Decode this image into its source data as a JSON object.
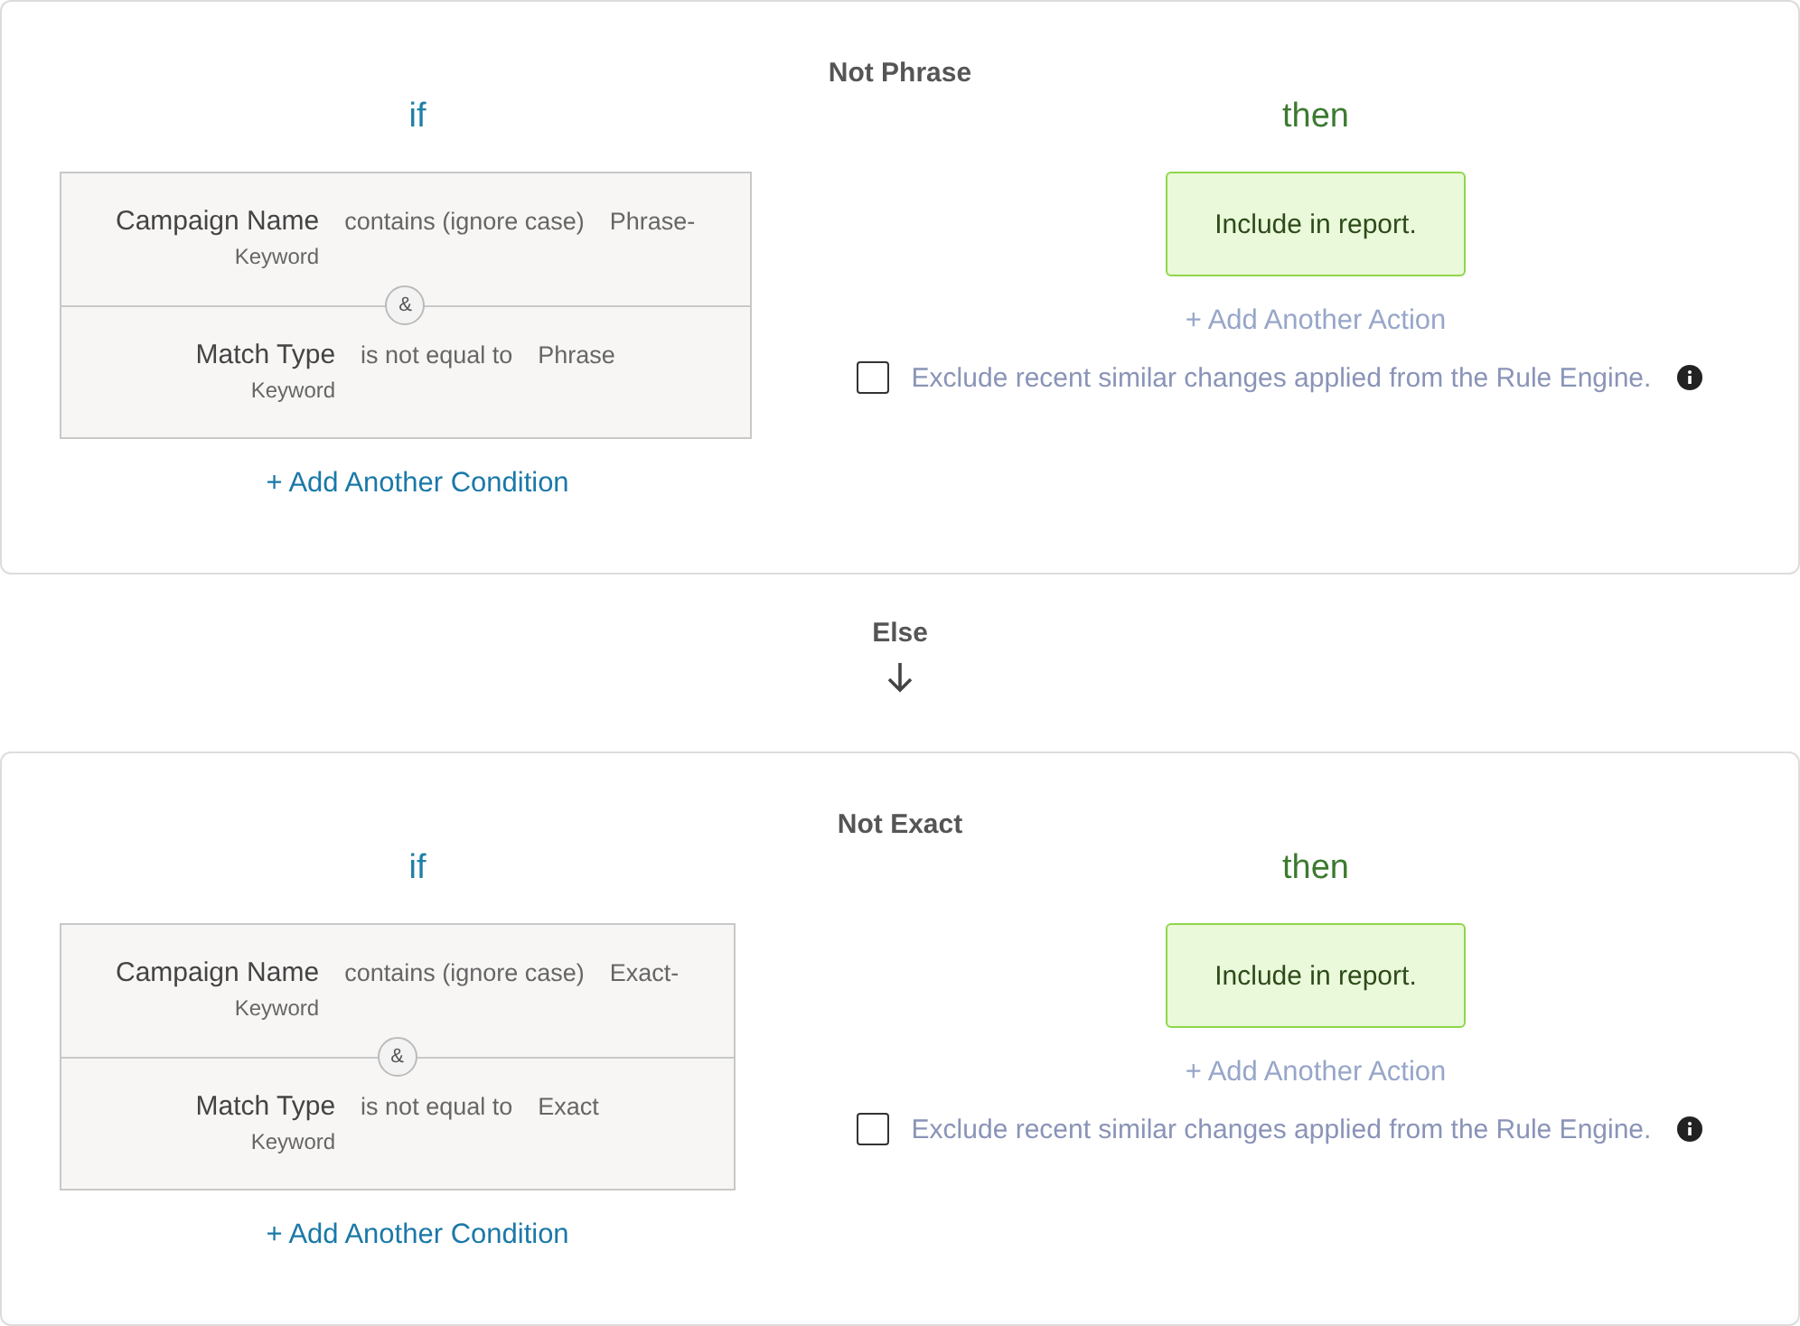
{
  "rules": [
    {
      "title": "Not Phrase",
      "if_label": "if",
      "then_label": "then",
      "conditions": [
        {
          "field": "Campaign Name",
          "entity": "Keyword",
          "operator": "contains (ignore case)",
          "value": "Phrase-"
        },
        {
          "field": "Match Type",
          "entity": "Keyword",
          "operator": "is not equal to",
          "value": "Phrase"
        }
      ],
      "joiner": "&",
      "add_condition": "+ Add Another Condition",
      "action": "Include in report.",
      "add_action": "+ Add Another Action",
      "exclude": {
        "label": "Exclude recent similar changes applied from the Rule Engine.",
        "checked": false
      }
    },
    {
      "title": "Not Exact",
      "if_label": "if",
      "then_label": "then",
      "conditions": [
        {
          "field": "Campaign Name",
          "entity": "Keyword",
          "operator": "contains (ignore case)",
          "value": "Exact-"
        },
        {
          "field": "Match Type",
          "entity": "Keyword",
          "operator": "is not equal to",
          "value": "Exact"
        }
      ],
      "joiner": "&",
      "add_condition": "+ Add Another Condition",
      "action": "Include in report.",
      "add_action": "+ Add Another Action",
      "exclude": {
        "label": "Exclude recent similar changes applied from the Rule Engine.",
        "checked": false
      }
    }
  ],
  "else_label": "Else"
}
